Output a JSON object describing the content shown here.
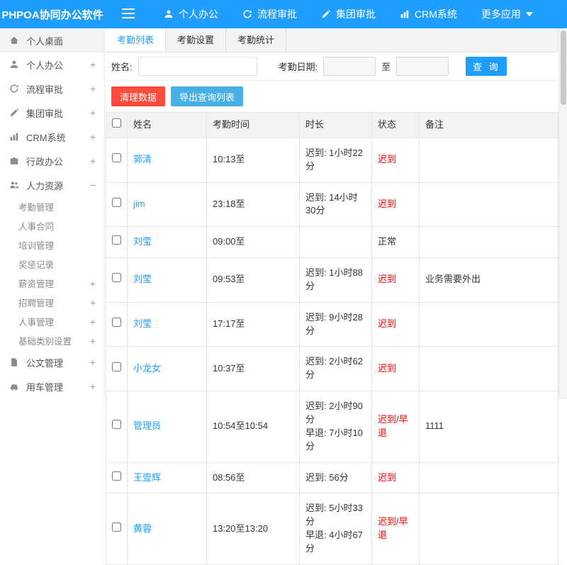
{
  "colors": {
    "primary": "#1f9eff",
    "danger": "#ff4a3c",
    "export": "#47b0e6",
    "status_red": "#ff0000"
  },
  "header": {
    "logo": "PHPOA协同办公软件",
    "nav": [
      {
        "label": "个人办公",
        "icon": "user-icon"
      },
      {
        "label": "流程审批",
        "icon": "workflow-icon"
      },
      {
        "label": "集团审批",
        "icon": "edit-icon"
      },
      {
        "label": "CRM系统",
        "icon": "bar-chart-icon"
      },
      {
        "label": "更多应用",
        "icon": "caret-down-icon"
      }
    ]
  },
  "sidebar": {
    "items": [
      {
        "label": "个人桌面",
        "expand": "",
        "icon": "home-icon"
      },
      {
        "label": "个人办公",
        "expand": "+",
        "icon": "user-icon"
      },
      {
        "label": "流程审批",
        "expand": "+",
        "icon": "workflow-icon"
      },
      {
        "label": "集团审批",
        "expand": "+",
        "icon": "edit-icon"
      },
      {
        "label": "CRM系统",
        "expand": "+",
        "icon": "bar-chart-icon"
      },
      {
        "label": "行政办公",
        "expand": "+",
        "icon": "briefcase-icon"
      },
      {
        "label": "人力资源",
        "expand": "−",
        "icon": "people-icon"
      },
      {
        "label": "公文管理",
        "expand": "+",
        "icon": "document-icon"
      },
      {
        "label": "用车管理",
        "expand": "+",
        "icon": "car-icon"
      }
    ],
    "hr_children": [
      {
        "label": "考勤管理",
        "expand": ""
      },
      {
        "label": "人事合同",
        "expand": ""
      },
      {
        "label": "培训管理",
        "expand": ""
      },
      {
        "label": "奖惩记录",
        "expand": ""
      },
      {
        "label": "薪资管理",
        "expand": "+"
      },
      {
        "label": "招聘管理",
        "expand": "+"
      },
      {
        "label": "人事管理",
        "expand": "+"
      },
      {
        "label": "基础类别设置",
        "expand": "+"
      }
    ]
  },
  "tabs": [
    {
      "label": "考勤列表",
      "active": true
    },
    {
      "label": "考勤设置",
      "active": false
    },
    {
      "label": "考勤统计",
      "active": false
    }
  ],
  "filters": {
    "name_label": "姓名:",
    "name_value": "",
    "date_label": "考勤日期:",
    "date_from": "",
    "to_label": "至",
    "date_to": "",
    "search_label": "查 询"
  },
  "actions": {
    "clear_label": "清理数据",
    "export_label": "导出查询列表"
  },
  "table": {
    "headers": [
      "姓名",
      "考勤时间",
      "时长",
      "状态",
      "备注"
    ],
    "rows": [
      {
        "name": "郭清",
        "time": "10:13至",
        "duration": "迟到: 1小时22分",
        "duration2": "",
        "status": "迟到",
        "status_style": "color:#ff0000",
        "note": ""
      },
      {
        "name": "jim",
        "time": "23:18至",
        "duration": "迟到: 14小时30分",
        "duration2": "",
        "status": "迟到",
        "status_style": "color:#ff0000",
        "note": ""
      },
      {
        "name": "刘莹",
        "time": "09:00至",
        "duration": "",
        "duration2": "",
        "status": "正常",
        "status_style": "color:#333333",
        "note": ""
      },
      {
        "name": "刘莹",
        "time": "09:53至",
        "duration": "迟到: 1小时88分",
        "duration2": "",
        "status": "迟到",
        "status_style": "color:#ff0000",
        "note": "业务需要外出"
      },
      {
        "name": "刘莹",
        "time": "17:17至",
        "duration": "迟到: 9小时28分",
        "duration2": "",
        "status": "迟到",
        "status_style": "color:#ff0000",
        "note": ""
      },
      {
        "name": "小龙女",
        "time": "10:37至",
        "duration": "迟到: 2小时62分",
        "duration2": "",
        "status": "迟到",
        "status_style": "color:#ff0000",
        "note": ""
      },
      {
        "name": "管理员",
        "time": "10:54至10:54",
        "duration": "迟到: 2小时90分",
        "duration2": "早退: 7小时10分",
        "status": "迟到/早退",
        "status_style": "color:#ff0000",
        "note": "1111"
      },
      {
        "name": "王壹辉",
        "time": "08:56至",
        "duration": "迟到: 56分",
        "duration2": "",
        "status": "迟到",
        "status_style": "color:#ff0000",
        "note": ""
      },
      {
        "name": "黄蓉",
        "time": "13:20至13:20",
        "duration": "迟到: 5小时33分",
        "duration2": "早退: 4小时67分",
        "status": "迟到/早退",
        "status_style": "color:#ff0000",
        "note": ""
      }
    ]
  }
}
